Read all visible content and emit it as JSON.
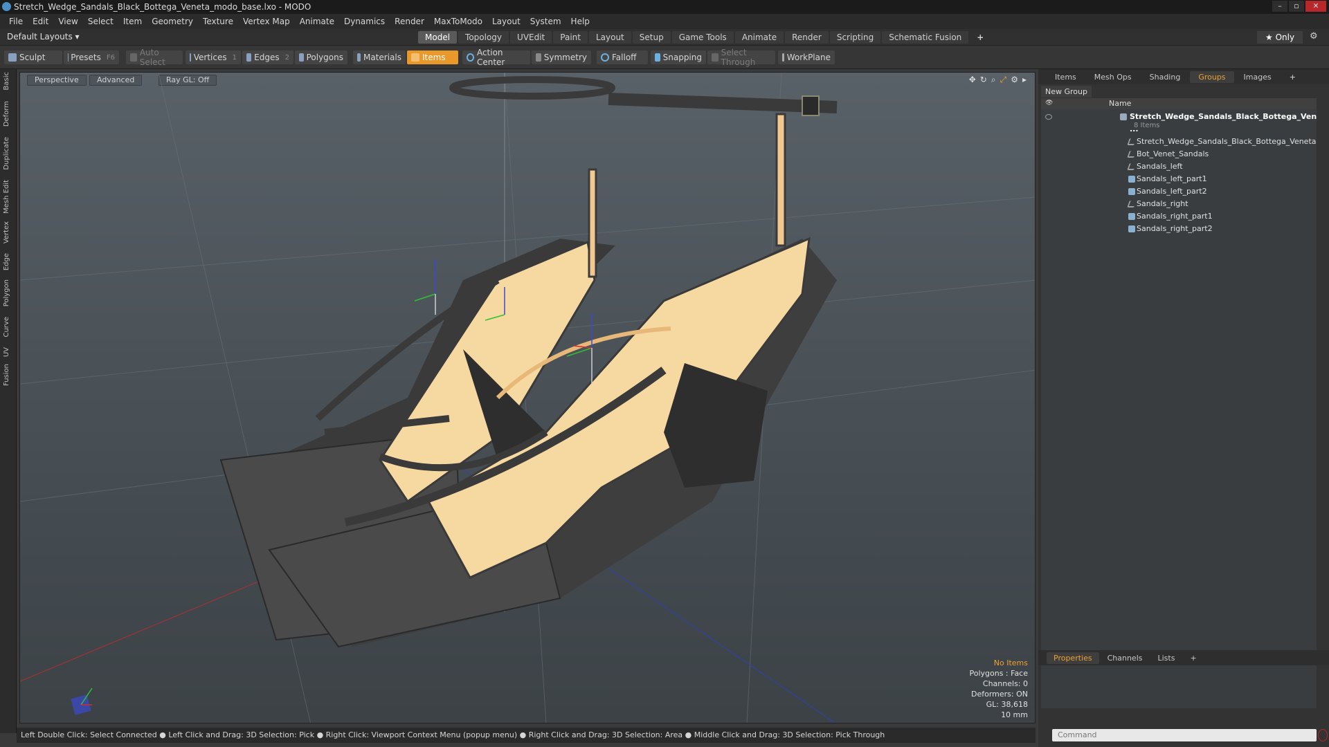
{
  "window": {
    "title": "Stretch_Wedge_Sandals_Black_Bottega_Veneta_modo_base.lxo - MODO"
  },
  "menu": [
    "File",
    "Edit",
    "View",
    "Select",
    "Item",
    "Geometry",
    "Texture",
    "Vertex Map",
    "Animate",
    "Dynamics",
    "Render",
    "MaxToModo",
    "Layout",
    "System",
    "Help"
  ],
  "layout": {
    "selector": "Default Layouts ▾",
    "tabs": [
      "Model",
      "Topology",
      "UVEdit",
      "Paint",
      "Layout",
      "Setup",
      "Game Tools",
      "Animate",
      "Render",
      "Scripting",
      "Schematic Fusion"
    ],
    "active_tab": "Model",
    "only_label": "★  Only"
  },
  "toolbar": {
    "sculpt": "Sculpt",
    "presets": "Presets",
    "presets_key": "F6",
    "auto_select": "Auto Select",
    "vertices": "Vertices",
    "vertices_num": "1",
    "edges": "Edges",
    "edges_num": "2",
    "polygons": "Polygons",
    "materials": "Materials",
    "items": "Items",
    "action_center": "Action Center",
    "symmetry": "Symmetry",
    "falloff": "Falloff",
    "snapping": "Snapping",
    "select_through": "Select Through",
    "workplane": "WorkPlane"
  },
  "left_tabs": [
    "Basic",
    "Deform",
    "Duplicate",
    "Mesh Edit",
    "Vertex",
    "Edge",
    "Polygon",
    "Curve",
    "UV",
    "Fusion"
  ],
  "viewport": {
    "view_label": "Perspective",
    "shading_label": "Advanced",
    "raygl_label": "Ray GL: Off",
    "info": {
      "selection": "No Items",
      "polygons": "Polygons : Face",
      "channels": "Channels: 0",
      "deformers": "Deformers: ON",
      "gl": "GL: 38,618",
      "scale": "10 mm"
    }
  },
  "status_bar": "Left Double Click: Select Connected ● Left Click and Drag: 3D Selection: Pick ● Right Click: Viewport Context Menu (popup menu) ● Right Click and Drag: 3D Selection: Area ● Middle Click and Drag: 3D Selection: Pick Through",
  "right_panel": {
    "tabs": [
      "Items",
      "Mesh Ops",
      "Shading",
      "Groups",
      "Images"
    ],
    "active_tab": "Groups",
    "new_group": "New Group",
    "column_name": "Name",
    "group_name": "Stretch_Wedge_Sandals_Black_Bottega_Ven ...",
    "group_count": "8 Items",
    "items": [
      {
        "name": "Stretch_Wedge_Sandals_Black_Bottega_Veneta",
        "icon": "locator-icon"
      },
      {
        "name": "Bot_Venet_Sandals",
        "icon": "locator-icon"
      },
      {
        "name": "Sandals_left",
        "icon": "locator-icon"
      },
      {
        "name": "Sandals_left_part1",
        "icon": "mesh-icon"
      },
      {
        "name": "Sandals_left_part2",
        "icon": "mesh-icon"
      },
      {
        "name": "Sandals_right",
        "icon": "locator-icon"
      },
      {
        "name": "Sandals_right_part1",
        "icon": "mesh-icon"
      },
      {
        "name": "Sandals_right_part2",
        "icon": "mesh-icon"
      }
    ],
    "bottom_tabs": [
      "Properties",
      "Channels",
      "Lists"
    ],
    "bottom_active": "Properties",
    "command_placeholder": "Command"
  },
  "colors": {
    "accent": "#e8992a",
    "insole": "#f5d9a0",
    "sandal_dark": "#3a3a3a"
  }
}
